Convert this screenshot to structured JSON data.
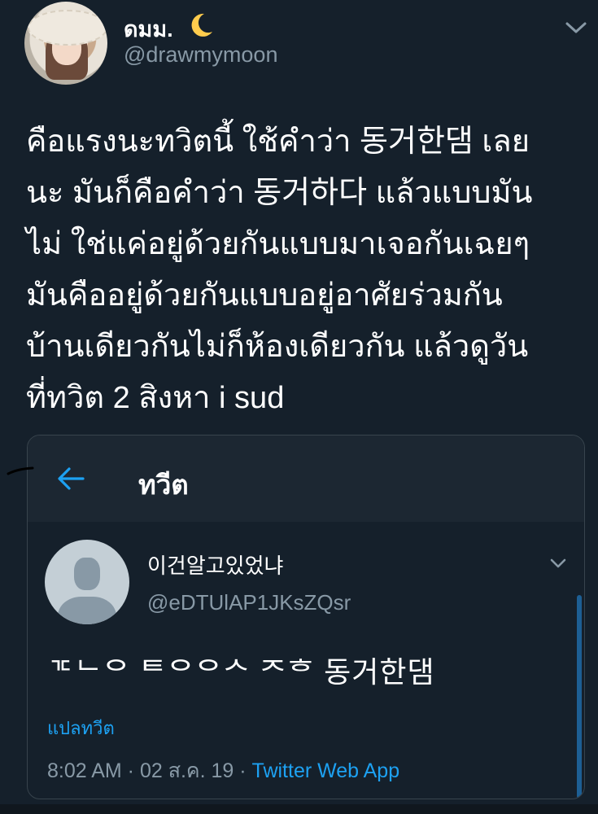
{
  "author": {
    "display_name": "ดมม.",
    "moon_icon": "crescent-moon-emoji",
    "handle": "@drawmymoon"
  },
  "tweet": {
    "lines": [
      "คือแรงนะทวิตนี้ ใช้คำว่า 동거한댐 เลย",
      "นะ มันก็คือคำว่า 동거하다 แล้วแบบมัน",
      "ไม่ ใช่แค่อยู่ด้วยกันแบบมาเจอกันเฉยๆ",
      "มันคืออยู่ด้วยกันแบบอยู่อาศัยร่วมกัน",
      "บ้านเดียวกันไม่ก็ห้องเดียวกัน แล้วดูวัน",
      "ที่ทวิต 2 สิงหา i sud"
    ]
  },
  "quoted_screenshot": {
    "header_title": "ทวีต",
    "author_name": "이건알고있었냐",
    "author_handle": "@eDTUlAP1JKsZQsr",
    "text": "ᄀᄃᄂᄋ ᄐᄋᄋᄉ ᄌᄒ 동거한댐",
    "translate_label": "แปลทวีต",
    "timestamp": "8:02 AM · 02 ส.ค. 19 · ",
    "source_app": "Twitter Web App"
  },
  "colors": {
    "background": "#15202b",
    "header_background": "#1c2732",
    "accent": "#1da1f2",
    "secondary_text": "#8899a6",
    "border": "#38444d"
  }
}
